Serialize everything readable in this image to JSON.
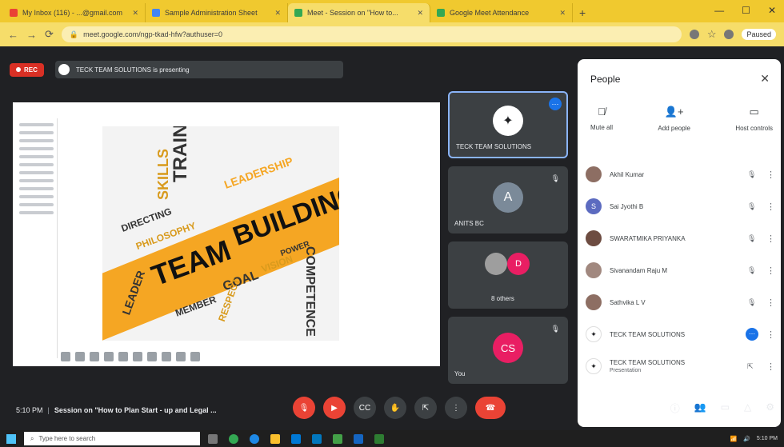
{
  "browser": {
    "tabs": [
      {
        "label": "My Inbox (116) - ...@gmail.com",
        "color": "#ea4335",
        "active": false
      },
      {
        "label": "Sample Administration Sheet",
        "color": "#4285f4",
        "active": false
      },
      {
        "label": "Meet - Session on \"How to...",
        "color": "#34a853",
        "active": true
      },
      {
        "label": "Google Meet Attendance",
        "color": "#34a853",
        "active": false
      }
    ],
    "url": "meet.google.com/ngp-tkad-hfw?authuser=0",
    "profile_label": "Paused"
  },
  "meet": {
    "rec_label": "REC",
    "presenting_text": "TECK TEAM SOLUTIONS is presenting",
    "slide": {
      "poster_words": {
        "team": "TEAM",
        "building": "BUILDING",
        "training": "TRAINING",
        "leadership": "LEADERSHIP",
        "directing": "DIRECTING",
        "philosophy": "PHILOSOPHY",
        "goal": "GOAL",
        "vision": "VISION",
        "competence": "COMPETENCE",
        "member": "MEMBER",
        "leader": "LEADER",
        "respect": "RESPECT",
        "power": "POWER",
        "skills": "SKILLS"
      }
    },
    "tiles": [
      {
        "name": "TECK TEAM SOLUTIONS",
        "initial": "",
        "color": "#ffffff"
      },
      {
        "name": "ANITS BC",
        "initial": "A",
        "color": "#7b8a99"
      },
      {
        "name": "8 others",
        "initial": "D",
        "color": "#e91e63"
      },
      {
        "name": "You",
        "initial": "CS",
        "color": "#e91e63"
      }
    ],
    "people_panel": {
      "title": "People",
      "actions": [
        {
          "label": "Mute all",
          "icon": "mic-off-icon"
        },
        {
          "label": "Add people",
          "icon": "add-person-icon"
        },
        {
          "label": "Host controls",
          "icon": "host-controls-icon"
        }
      ],
      "participants": [
        {
          "name": "Akhil Kumar",
          "avatar_color": "#8d6e63",
          "initial": ""
        },
        {
          "name": "Sai Jyothi B",
          "avatar_color": "#5c6bc0",
          "initial": "S"
        },
        {
          "name": "SWARATMIKA PRIYANKA",
          "avatar_color": "#6d4c41",
          "initial": ""
        },
        {
          "name": "Sivanandam Raju M",
          "avatar_color": "#a1887f",
          "initial": ""
        },
        {
          "name": "Sathvika L V",
          "avatar_color": "#8d6e63",
          "initial": ""
        },
        {
          "name": "TECK TEAM SOLUTIONS",
          "avatar_color": "#ffffff",
          "initial": ""
        },
        {
          "name": "TECK TEAM SOLUTIONS",
          "sub": "Presentation",
          "avatar_color": "#ffffff",
          "initial": ""
        }
      ]
    },
    "bottom": {
      "time": "5:10 PM",
      "meeting_title": "Session on \"How to Plan Start - up and Legal ..."
    }
  },
  "taskbar": {
    "search_placeholder": "Type here to search",
    "time": "5:10 PM"
  }
}
